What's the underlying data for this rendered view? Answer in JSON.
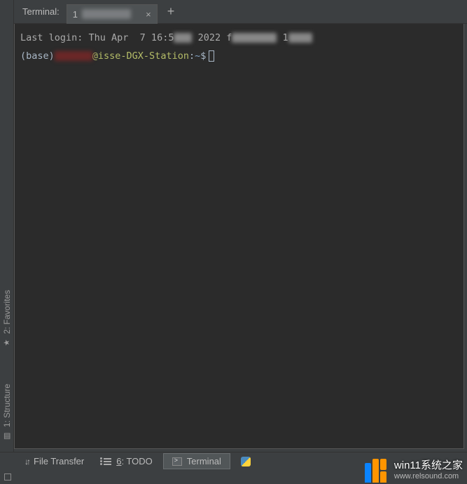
{
  "header": {
    "title": "Terminal:",
    "tab_prefix": "1",
    "plus": "+"
  },
  "terminal": {
    "login_prefix": "Last login: Thu Apr  7 16:5",
    "login_mid": " 2022 f",
    "login_suffix": " 1",
    "prompt_base": "(base)",
    "prompt_userhost": "@isse-DGX-Station",
    "prompt_colon": ":",
    "prompt_path": "~",
    "prompt_dollar": "$"
  },
  "left_tabs": {
    "structure": "1: Structure",
    "favorites": "2: Favorites"
  },
  "bottom": {
    "file_transfer": "File Transfer",
    "todo_num": "6",
    "todo_label": ": TODO",
    "terminal": "Terminal"
  },
  "watermark": {
    "cn": "win11系统之家",
    "url": "www.relsound.com"
  }
}
